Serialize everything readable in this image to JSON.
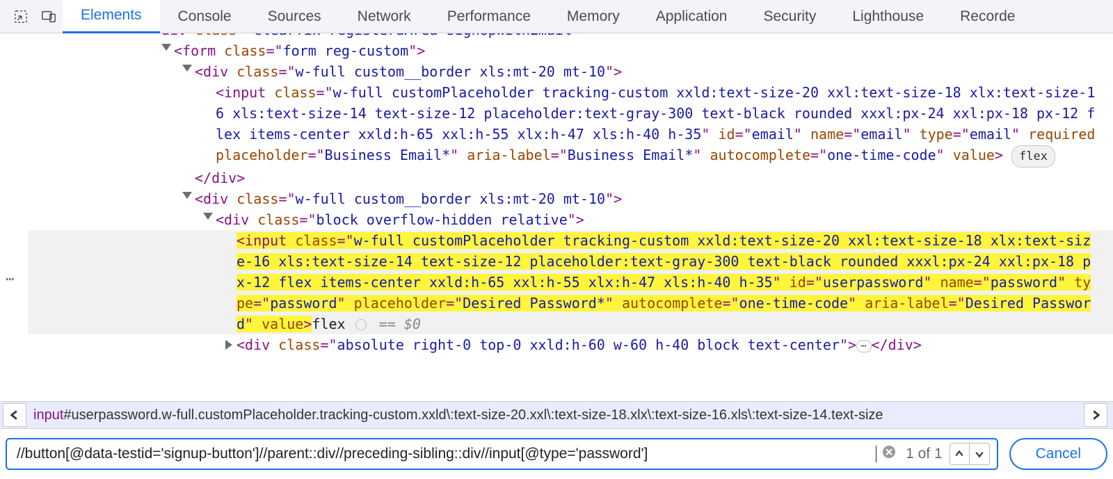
{
  "tabs": {
    "items": [
      "Elements",
      "Console",
      "Sources",
      "Network",
      "Performance",
      "Memory",
      "Application",
      "Security",
      "Lighthouse",
      "Recorde"
    ],
    "active_index": 0
  },
  "dom": {
    "l0": {
      "tag": "div",
      "class_attr": "clearfix registeraArea signUpWithEmail"
    },
    "l1": {
      "tag": "form",
      "class_attr": "form reg-custom"
    },
    "l2": {
      "tag": "div",
      "class_attr": "w-full custom__border xls:mt-20 mt-10"
    },
    "l3": {
      "tag": "input",
      "class_attr": "w-full customPlaceholder tracking-custom xxld:text-size-20 xxl:text-size-18 xlx:text-size-16 xls:text-size-14 text-size-12 placeholder:text-gray-300 text-black rounded xxxl:px-24 xxl:px-18 px-12 flex items-center xxld:h-65 xxl:h-55 xlx:h-47 xls:h-40 h-35",
      "id": "email",
      "name_attr": "email",
      "type": "email",
      "required": "required",
      "placeholder": "Business Email*",
      "aria_label": "Business Email*",
      "autocomplete": "one-time-code",
      "badge": "flex"
    },
    "l4": {
      "close": "div"
    },
    "l5": {
      "tag": "div",
      "class_attr": "w-full custom__border xls:mt-20 mt-10"
    },
    "l6": {
      "tag": "div",
      "class_attr": "block overflow-hidden relative"
    },
    "l7": {
      "tag": "input",
      "class_attr": "w-full customPlaceholder tracking-custom xxld:text-size-20 xxl:text-size-18 xlx:text-size-16 xls:text-size-14 text-size-12 placeholder:text-gray-300 text-black rounded xxxl:px-24 xxl:px-18 px-12 flex items-center xxld:h-65 xxl:h-55 xlx:h-47 xls:h-40 h-35",
      "id": "userpassword",
      "name_attr": "password",
      "type": "password",
      "placeholder": "Desired Password*",
      "autocomplete": "one-time-code",
      "aria_label": "Desired Password",
      "trail_text": "flex",
      "eq": "== $0"
    },
    "l8": {
      "tag": "div",
      "class_attr": "absolute right-0 top-0 xxld:h-60 w-60 h-40 block text-center",
      "close": "div"
    }
  },
  "breadcrumb": {
    "tag": "input",
    "rest": "#userpassword.w-full.customPlaceholder.tracking-custom.xxld\\:text-size-20.xxl\\:text-size-18.xlx\\:text-size-16.xls\\:text-size-14.text-size"
  },
  "search": {
    "query": "//button[@data-testid='signup-button']//parent::div//preceding-sibling::div//input[@type='password']",
    "count": "1 of 1",
    "cancel": "Cancel"
  },
  "labels": {
    "k_class": "class",
    "k_id": "id",
    "k_name": "name",
    "k_type": "type",
    "k_required": "required",
    "k_placeholder": "placeholder",
    "k_arialabel": "aria-label",
    "k_autocomplete": "autocomplete",
    "k_value": "value"
  }
}
